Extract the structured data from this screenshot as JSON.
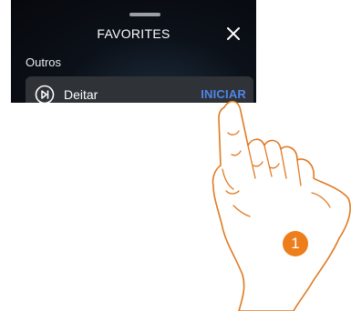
{
  "header": {
    "title": "FAVORITES",
    "close_icon": "close-icon"
  },
  "section": {
    "label": "Outros"
  },
  "favorite": {
    "icon": "skip-play-icon",
    "label": "Deitar",
    "action_label": "INICIAR"
  },
  "annotation": {
    "step_number": "1"
  },
  "colors": {
    "screen_bg": "#06080c",
    "row_bg": "#2f3338",
    "action_blue": "#4f86e8",
    "hand_stroke": "#e07a22",
    "badge": "#ee7d1c"
  }
}
